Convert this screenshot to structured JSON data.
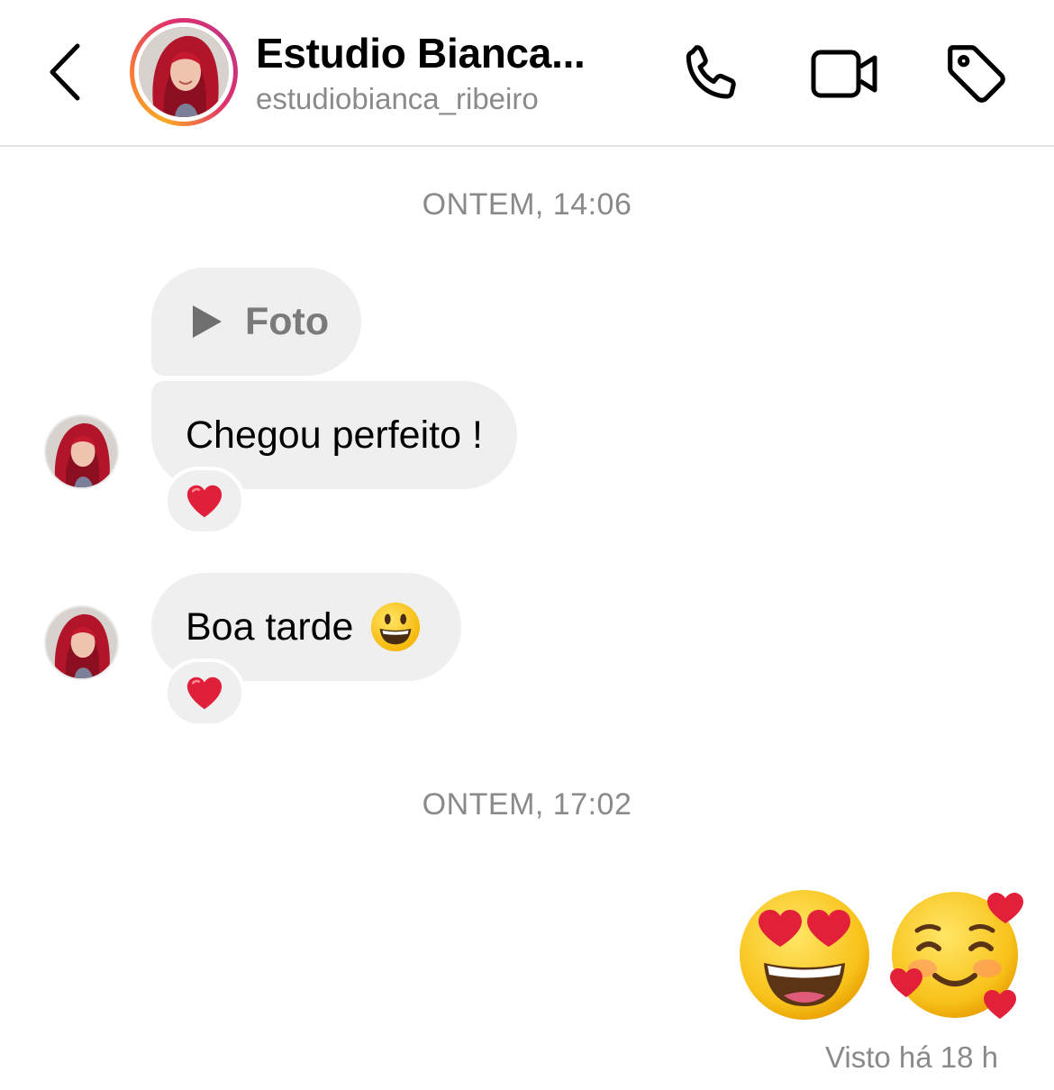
{
  "header": {
    "contact_name": "Estudio Bianca...",
    "username": "estudiobianca_ribeiro",
    "icons": {
      "back": "chevron-left-icon",
      "call": "phone-icon",
      "video": "video-camera-icon",
      "tag": "tag-icon"
    }
  },
  "conversation": {
    "timestamp_1": "ONTEM, 14:06",
    "messages": [
      {
        "type": "photo",
        "label": "Foto"
      },
      {
        "type": "text",
        "text": "Chegou perfeito !",
        "reaction": "❤️"
      },
      {
        "type": "text",
        "text": "Boa tarde",
        "emoji": "smiley-icon",
        "reaction": "❤️"
      }
    ],
    "timestamp_2": "ONTEM, 17:02",
    "sent_message": {
      "emojis": [
        "heart-eyes-emoji",
        "smiling-face-with-hearts-emoji"
      ]
    },
    "seen_status": "Visto há 18 h"
  },
  "colors": {
    "bubble_bg": "#efefef",
    "muted_text": "#8a8a8a",
    "reaction_heart": "#e0203a"
  }
}
